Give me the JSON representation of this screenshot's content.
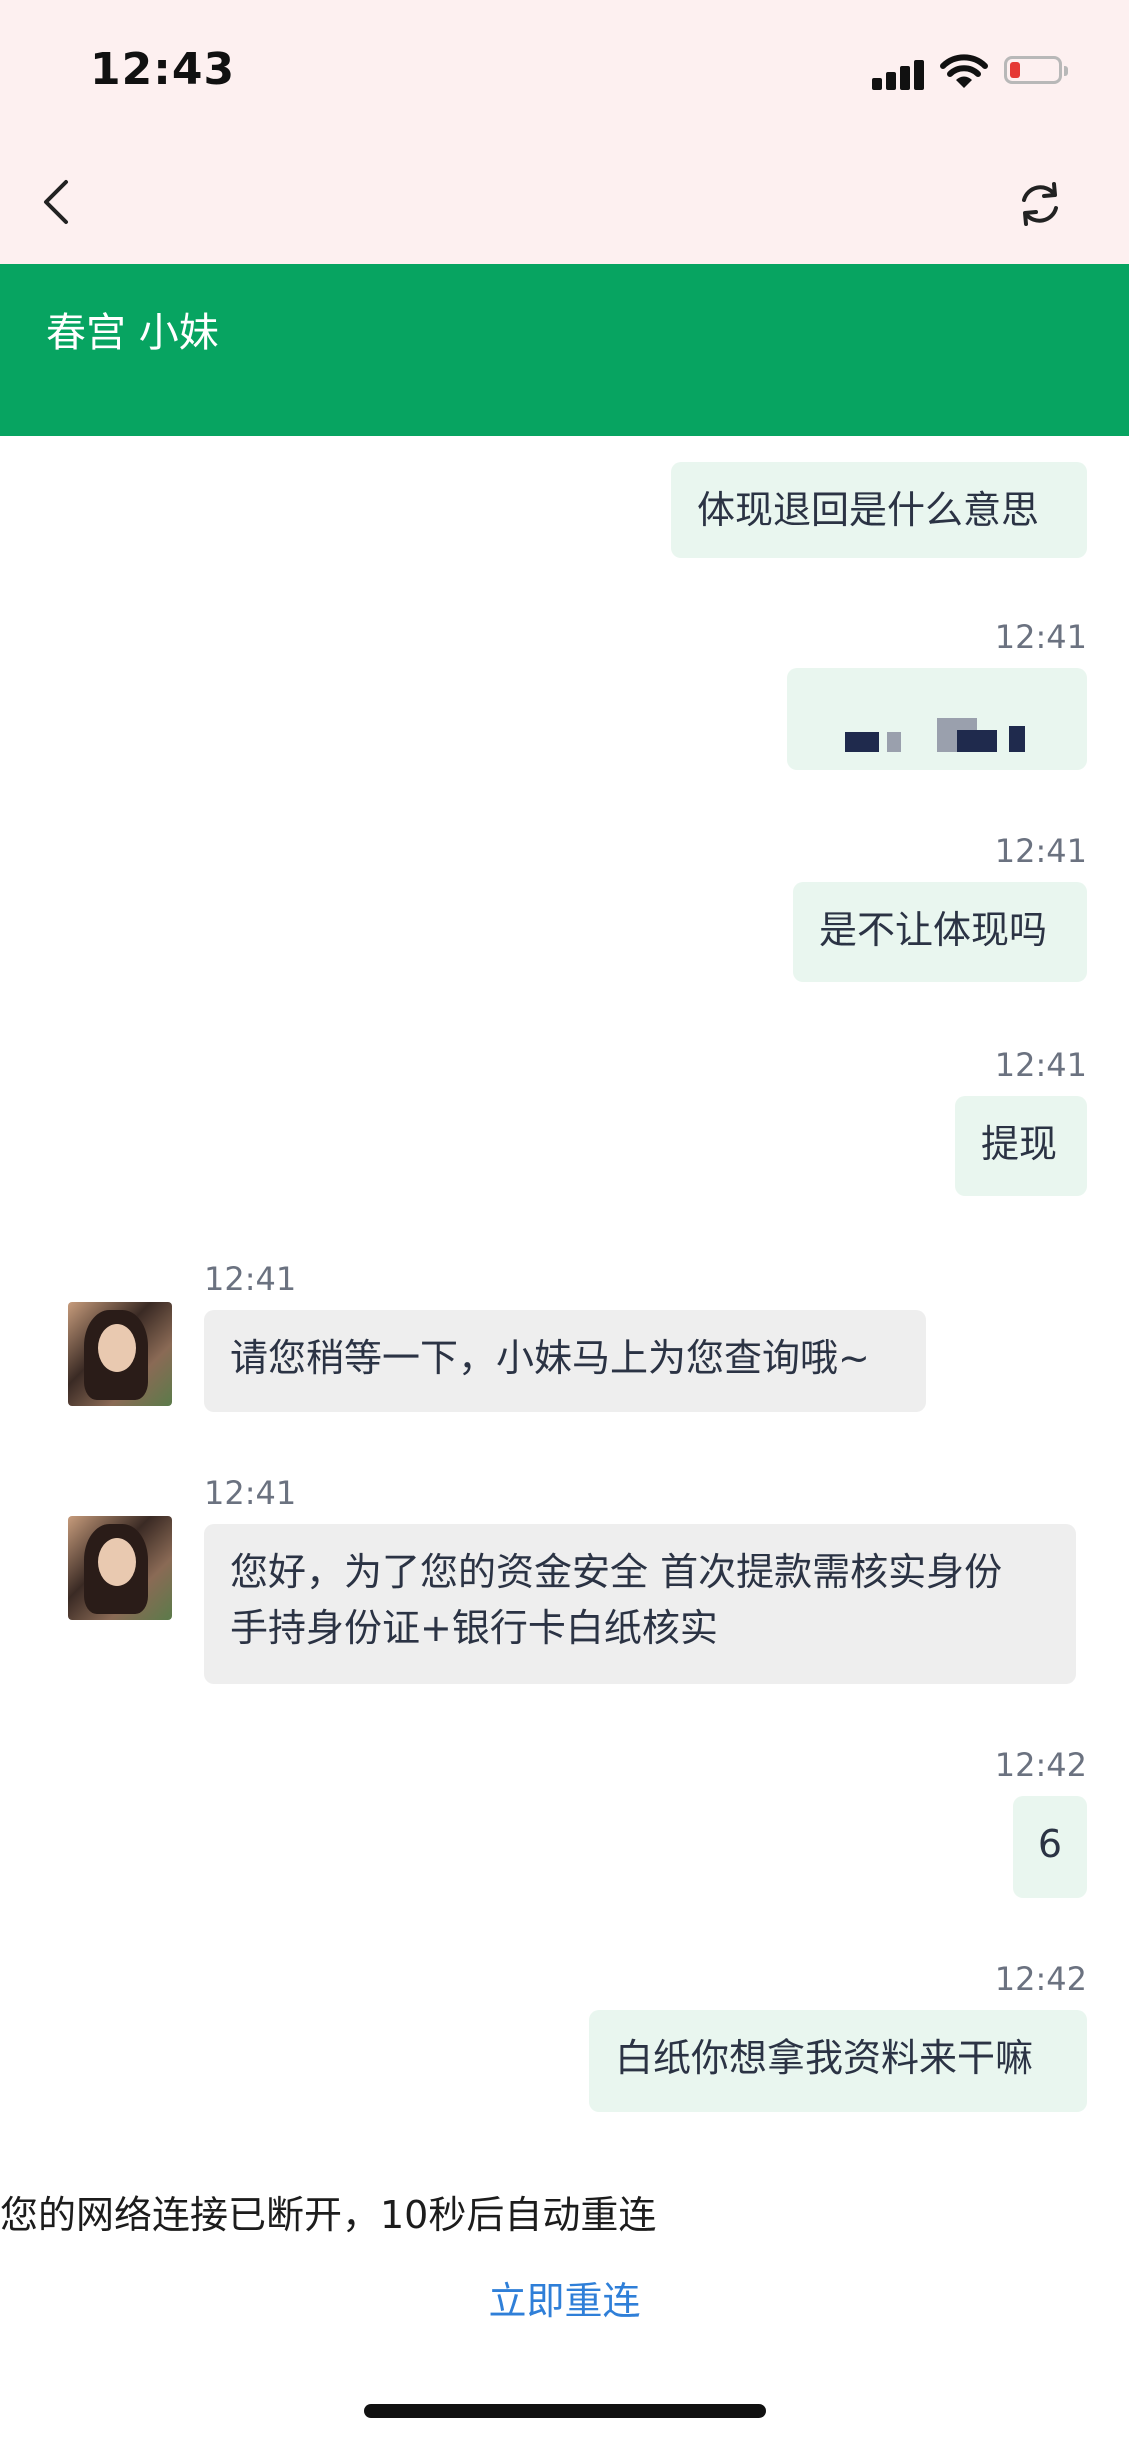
{
  "status_bar": {
    "time": "12:43"
  },
  "header": {
    "title": "春宫 小妹"
  },
  "messages": [
    {
      "type": "out",
      "text": "体现退回是什么意思"
    },
    {
      "type": "out",
      "time": "12:41",
      "text": "",
      "note": "pixelated image"
    },
    {
      "type": "out",
      "time": "12:41",
      "text": "是不让体现吗"
    },
    {
      "type": "out",
      "time": "12:41",
      "text": "提现"
    },
    {
      "type": "in",
      "time": "12:41",
      "text": "请您稍等一下，小妹马上为您查询哦~"
    },
    {
      "type": "in",
      "time": "12:41",
      "text": "您好，为了您的资金安全 首次提款需核实身份 手持身份证+银行卡白纸核实"
    },
    {
      "type": "out",
      "time": "12:42",
      "text": "6"
    },
    {
      "type": "out",
      "time": "12:42",
      "text": "白纸你想拿我资料来干嘛"
    }
  ],
  "footer": {
    "disconnect_text": "您的网络连接已断开，10秒后自动重连",
    "reconnect_label": "立即重连"
  },
  "colors": {
    "header_bg": "#07a461",
    "top_bg": "#fdf0f0",
    "out_bubble": "#e9f6ef",
    "in_bubble": "#eeeeee",
    "link": "#2f7fd8"
  }
}
